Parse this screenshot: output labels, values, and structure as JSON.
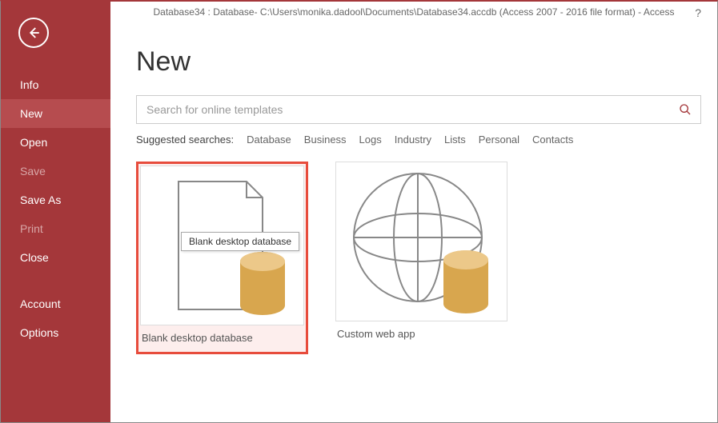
{
  "titlebar": "Database34 : Database- C:\\Users\\monika.dadool\\Documents\\Database34.accdb (Access 2007 - 2016 file format) - Access",
  "help": "?",
  "sidebar": {
    "items": [
      {
        "label": "Info",
        "state": "normal"
      },
      {
        "label": "New",
        "state": "active"
      },
      {
        "label": "Open",
        "state": "normal"
      },
      {
        "label": "Save",
        "state": "disabled"
      },
      {
        "label": "Save As",
        "state": "normal"
      },
      {
        "label": "Print",
        "state": "disabled"
      },
      {
        "label": "Close",
        "state": "normal"
      },
      {
        "label": "Account",
        "state": "normal"
      },
      {
        "label": "Options",
        "state": "normal"
      }
    ]
  },
  "page": {
    "title": "New",
    "search_placeholder": "Search for online templates",
    "suggested_label": "Suggested searches:",
    "suggested": [
      "Database",
      "Business",
      "Logs",
      "Industry",
      "Lists",
      "Personal",
      "Contacts"
    ]
  },
  "templates": [
    {
      "label": "Blank desktop database",
      "tooltip": "Blank desktop database",
      "selected": true,
      "icon": "blank-db"
    },
    {
      "label": "Custom web app",
      "selected": false,
      "icon": "web-app"
    }
  ]
}
